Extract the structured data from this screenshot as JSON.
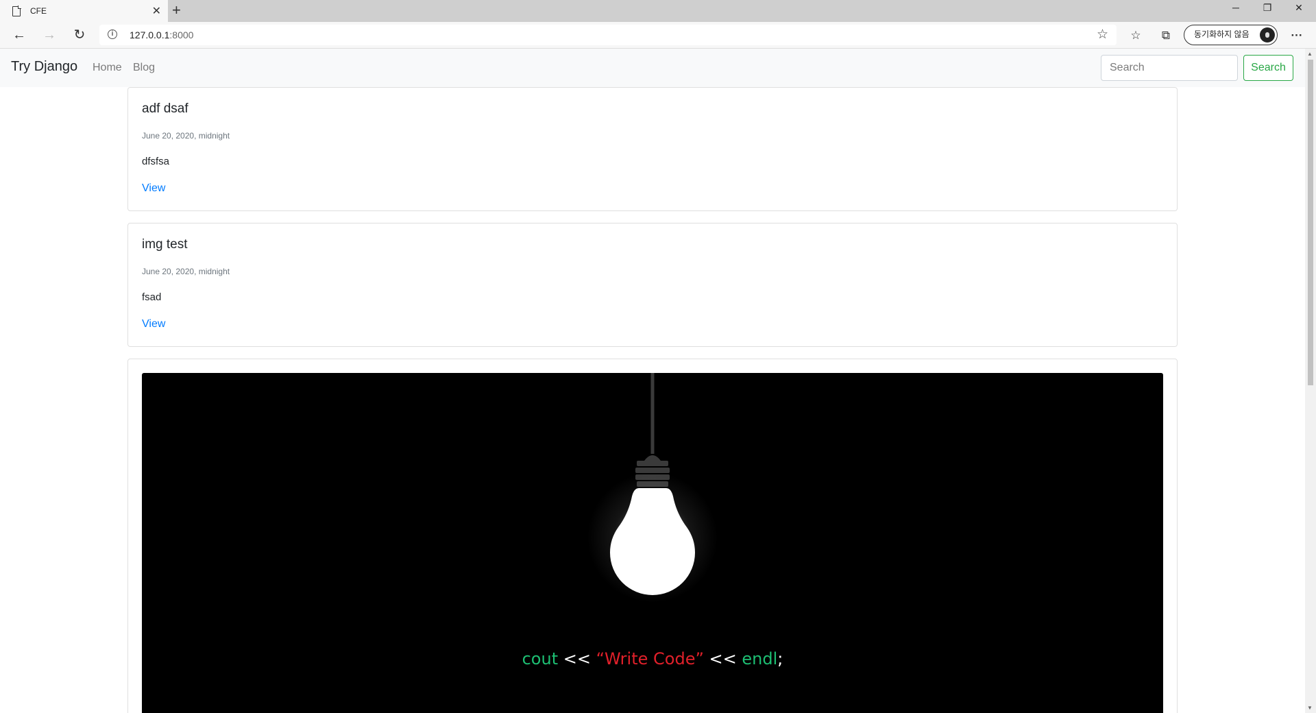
{
  "browser": {
    "tab_title": "CFE",
    "url_host": "127.0.0.1",
    "url_port": ":8000",
    "sync_label": "동기화하지 않음"
  },
  "site": {
    "brand": "Try Django",
    "nav": [
      "Home",
      "Blog"
    ],
    "search_placeholder": "Search",
    "search_button": "Search"
  },
  "posts": [
    {
      "title": "adf dsaf",
      "date": "June 20, 2020, midnight",
      "body": "dfsfsa",
      "link": "View"
    },
    {
      "title": "img test",
      "date": "June 20, 2020, midnight",
      "body": "fsad",
      "link": "View"
    }
  ],
  "image_post": {
    "code_parts": [
      {
        "text": "cout",
        "color": "#1dbf73"
      },
      {
        "text": " << ",
        "color": "#ffffff"
      },
      {
        "text": "“Write Code”",
        "color": "#e0202a"
      },
      {
        "text": " << ",
        "color": "#ffffff"
      },
      {
        "text": "endl",
        "color": "#1dbf73"
      },
      {
        "text": ";",
        "color": "#ffffff"
      }
    ]
  },
  "colors": {
    "primary": "#007bff",
    "success": "#28a745"
  }
}
